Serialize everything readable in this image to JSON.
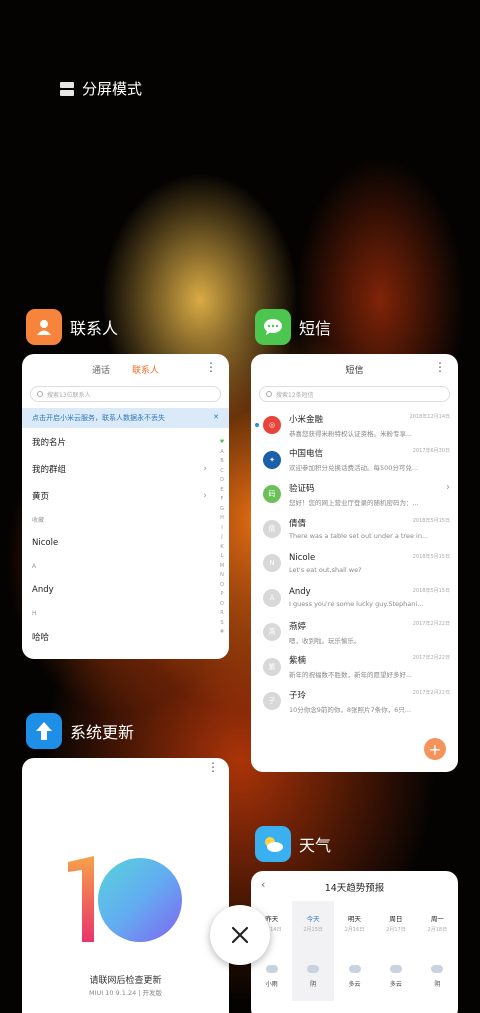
{
  "split_mode": {
    "label": "分屏模式"
  },
  "contacts_app": {
    "name": "联系人",
    "tabs": [
      "通话",
      "联系人"
    ],
    "search_placeholder": "搜索13位联系人",
    "banner": "点击开启小米云服务，联系人数据永不丢失",
    "banner_close": "✕",
    "rows": [
      {
        "label": "我的名片",
        "type": "row"
      },
      {
        "label": "我的群组",
        "type": "row",
        "chevron": true
      },
      {
        "label": "黄页",
        "type": "row",
        "chevron": true
      },
      {
        "label": "收藏",
        "type": "section"
      },
      {
        "label": "Nicole",
        "type": "row"
      },
      {
        "label": "A",
        "type": "section"
      },
      {
        "label": "Andy",
        "type": "row"
      },
      {
        "label": "H",
        "type": "section"
      },
      {
        "label": "哈哈",
        "type": "row"
      }
    ],
    "alphabet": [
      "♥",
      "A",
      "B",
      "C",
      "D",
      "E",
      "F",
      "G",
      "H",
      "I",
      "J",
      "K",
      "L",
      "M",
      "N",
      "O",
      "P",
      "Q",
      "R",
      "S",
      "#"
    ]
  },
  "sms_app": {
    "name": "短信",
    "title": "短信",
    "search_placeholder": "搜索12条短信",
    "messages": [
      {
        "name": "小米金融",
        "date": "2018年12月14日",
        "preview": "恭喜您获得米粉特权认证资格。米粉专享...",
        "avatar": "◎",
        "color": "#e8443a",
        "unread": true
      },
      {
        "name": "中国电信",
        "date": "2017年6月30日",
        "preview": "欢迎参加积分兑换话费活动。每500分可兑...",
        "avatar": "✦",
        "color": "#1b5faa",
        "unread": false
      },
      {
        "name": "验证码",
        "date": "",
        "preview": "您好！您的网上营业厅登录的随机密码为：...",
        "avatar": "码",
        "color": "#6cc05a",
        "unread": false,
        "chevron": true
      },
      {
        "name": "倩倩",
        "date": "2018年5月15日",
        "preview": "There was a table set out under a tree in...",
        "avatar": "倩",
        "color": "#d8d8d8",
        "unread": false
      },
      {
        "name": "Nicole",
        "date": "2018年5月15日",
        "preview": "Let's eat out,shall we?",
        "avatar": "N",
        "color": "#d8d8d8",
        "unread": false
      },
      {
        "name": "Andy",
        "date": "2018年5月15日",
        "preview": "I guess you're some lucky guy.Stephani...",
        "avatar": "A",
        "color": "#d8d8d8",
        "unread": false
      },
      {
        "name": "燕婷",
        "date": "2017年2月22日",
        "preview": "嗯，收到啦。玩乐愉乐。",
        "avatar": "燕",
        "color": "#d8d8d8",
        "unread": false
      },
      {
        "name": "紫楠",
        "date": "2017年2月22日",
        "preview": "新年的祝福数不胜数，新年的愿望好多好...",
        "avatar": "紫",
        "color": "#d8d8d8",
        "unread": false
      },
      {
        "name": "子玲",
        "date": "2017年2月22日",
        "preview": "10分你念9前的你，8张照片7条你，6只...",
        "avatar": "子",
        "color": "#d8d8d8",
        "unread": false
      }
    ],
    "fab": "+"
  },
  "update_app": {
    "name": "系统更新",
    "line1": "请联网后检查更新",
    "line2": "MIUI 10 9.1.24 | 开发版"
  },
  "weather_app": {
    "name": "天气",
    "title": "14天趋势预报",
    "back": "‹",
    "days": [
      {
        "name": "昨天",
        "date": "2月14日",
        "desc": "小雨",
        "active": false
      },
      {
        "name": "今天",
        "date": "2月15日",
        "desc": "阴",
        "active": true
      },
      {
        "name": "明天",
        "date": "2月16日",
        "desc": "多云",
        "active": false
      },
      {
        "name": "周日",
        "date": "2月17日",
        "desc": "多云",
        "active": false
      },
      {
        "name": "周一",
        "date": "2月18日",
        "desc": "阴",
        "active": false
      }
    ]
  },
  "more_menu": "⋮",
  "close_icon": "✕",
  "colors": {
    "accent_orange": "#f26a21",
    "blue": "#2b77c4"
  }
}
